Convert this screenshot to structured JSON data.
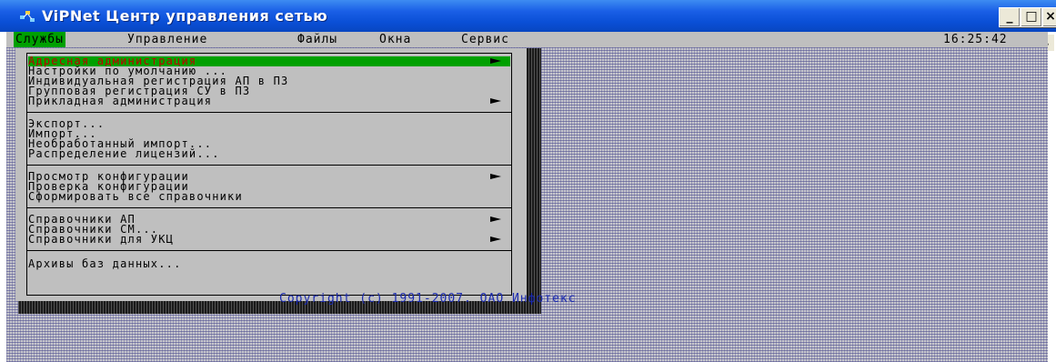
{
  "window": {
    "title": "ViPNet Центр управления сетью",
    "min_symbol": "_",
    "max_symbol": "□",
    "close_symbol": "×",
    "scroll_up_symbol": "▲"
  },
  "menubar": {
    "items": [
      {
        "label": "Службы",
        "selected": true
      },
      {
        "label": "Управление"
      },
      {
        "label": "Файлы"
      },
      {
        "label": "Окна"
      },
      {
        "label": "Сервис"
      }
    ],
    "clock": "16:25:42"
  },
  "dropdown": {
    "items": [
      {
        "label": "Адресная администрация",
        "submenu": true,
        "selected": true
      },
      {
        "label": "Настройки по умолчанию ..."
      },
      {
        "label": "Индивидуальная регистрация АП в ПЗ"
      },
      {
        "label": "Групповая регистрация СУ в ПЗ"
      },
      {
        "label": "Прикладная администрация",
        "submenu": true
      },
      {
        "label": "Экспорт..."
      },
      {
        "label": "Импорт..."
      },
      {
        "label": "Необработанный импорт..."
      },
      {
        "label": "Распределение лицензий..."
      },
      {
        "label": "Просмотр конфигурации",
        "submenu": true
      },
      {
        "label": "Проверка конфигурации"
      },
      {
        "label": "Сформировать все справочники"
      },
      {
        "label": "Справочники АП",
        "submenu": true
      },
      {
        "label": "Справочники СМ..."
      },
      {
        "label": "Справочники для УКЦ",
        "submenu": true
      },
      {
        "label": "Архивы баз данных..."
      }
    ]
  },
  "footer": {
    "copyright": "Copyright (c) 1991-2007. ОАО Инфотекс"
  },
  "colors": {
    "highlight": "#00a000",
    "hotkey": "#c00000",
    "copyright_text": "#1a2ab0"
  }
}
